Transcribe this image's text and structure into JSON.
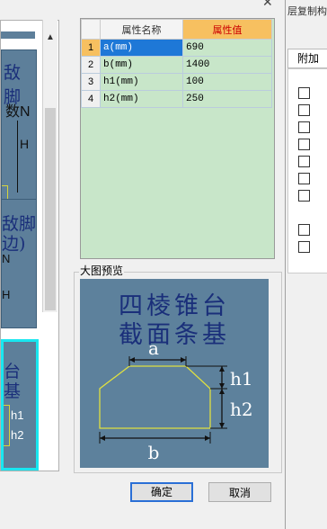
{
  "background_window": {
    "title_fragment": "层复制构",
    "column_header": "附加"
  },
  "left_panel": {
    "thumb1_lines": [
      "敌脚",
      "数N",
      "H"
    ],
    "thumb2_lines": [
      "敌脚",
      "边)",
      "N",
      "H"
    ],
    "thumb3_lines": [
      "台",
      "基",
      "h1",
      "h2"
    ]
  },
  "table": {
    "headers": [
      "属性名称",
      "属性值"
    ],
    "rows": [
      {
        "n": "1",
        "name": "a(mm)",
        "value": "690"
      },
      {
        "n": "2",
        "name": "b(mm)",
        "value": "1400"
      },
      {
        "n": "3",
        "name": "h1(mm)",
        "value": "100"
      },
      {
        "n": "4",
        "name": "h2(mm)",
        "value": "250"
      }
    ]
  },
  "preview": {
    "label": "大图预览",
    "title_line1": "四棱锥台",
    "title_line2": "截面条基",
    "dim_a": "a",
    "dim_b": "b",
    "dim_h1": "h1",
    "dim_h2": "h2"
  },
  "buttons": {
    "ok": "确定",
    "cancel": "取消"
  },
  "colors": {
    "preview_bg": "#5d819c",
    "table_bg": "#c8e6c9",
    "highlight": "#f7c060",
    "selection": "#1e78d7"
  }
}
